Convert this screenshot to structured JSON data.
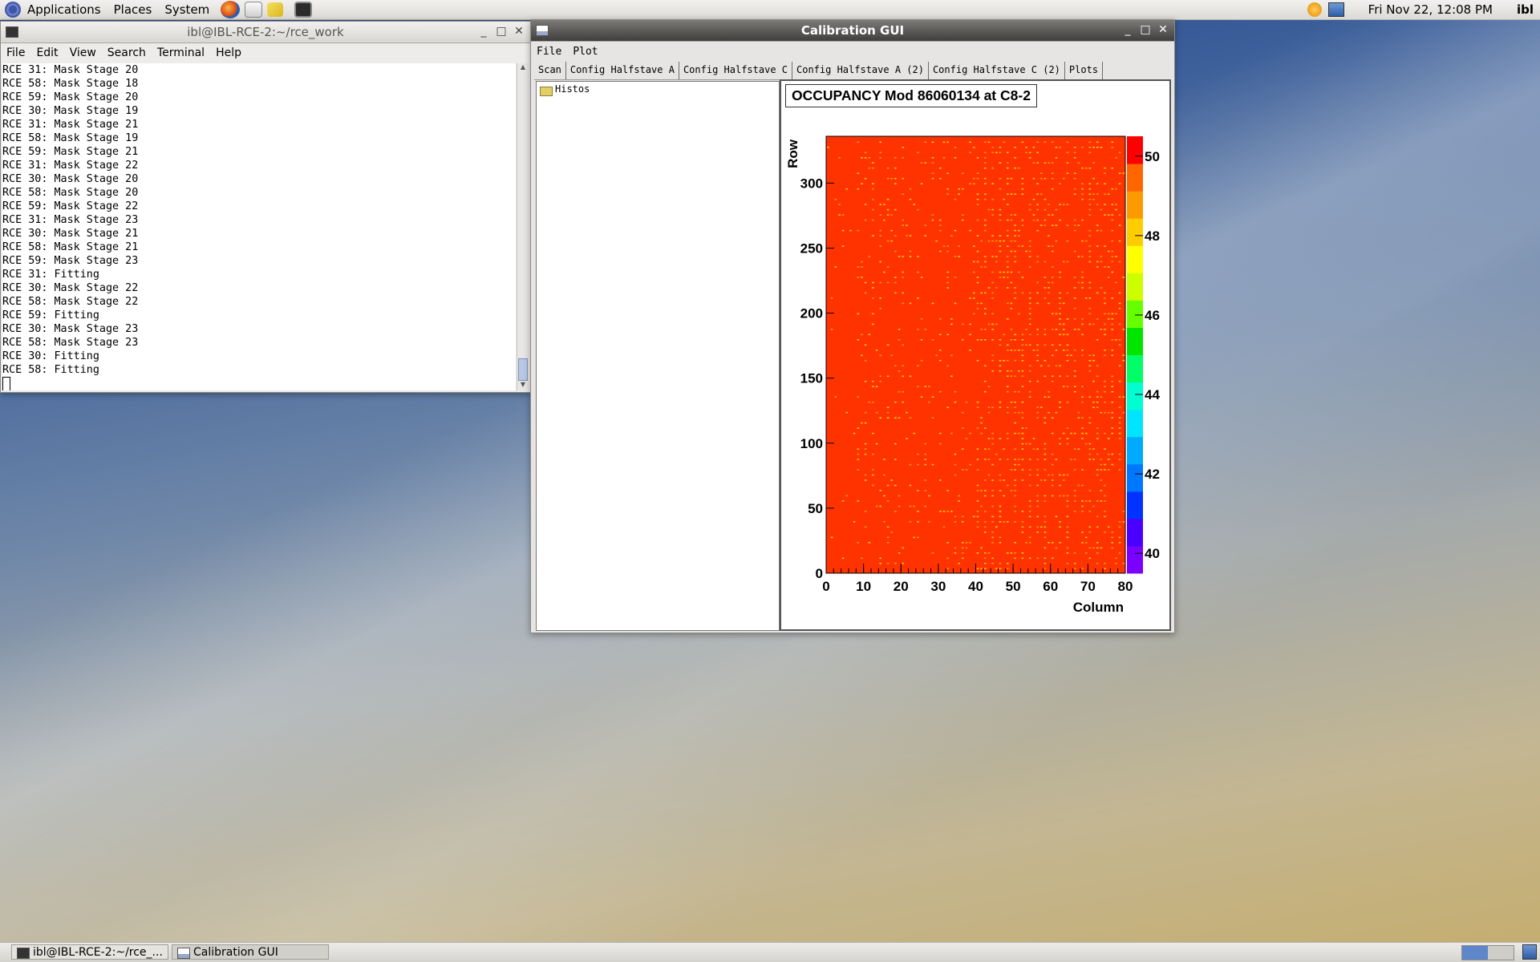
{
  "top_panel": {
    "menus": [
      "Applications",
      "Places",
      "System"
    ],
    "clock": "Fri Nov 22, 12:08 PM",
    "user": "ibl"
  },
  "terminal": {
    "title": "ibl@IBL-RCE-2:~/rce_work",
    "menus": [
      "File",
      "Edit",
      "View",
      "Search",
      "Terminal",
      "Help"
    ],
    "lines": [
      "RCE 31: Mask Stage 20",
      "RCE 58: Mask Stage 18",
      "RCE 59: Mask Stage 20",
      "RCE 30: Mask Stage 19",
      "RCE 31: Mask Stage 21",
      "RCE 58: Mask Stage 19",
      "RCE 59: Mask Stage 21",
      "RCE 31: Mask Stage 22",
      "RCE 30: Mask Stage 20",
      "RCE 58: Mask Stage 20",
      "RCE 59: Mask Stage 22",
      "RCE 31: Mask Stage 23",
      "RCE 30: Mask Stage 21",
      "RCE 58: Mask Stage 21",
      "RCE 59: Mask Stage 23",
      "RCE 31: Fitting",
      "RCE 30: Mask Stage 22",
      "RCE 58: Mask Stage 22",
      "RCE 59: Fitting",
      "RCE 30: Mask Stage 23",
      "RCE 58: Mask Stage 23",
      "RCE 30: Fitting",
      "RCE 58: Fitting"
    ]
  },
  "calib": {
    "title": "Calibration GUI",
    "menus": [
      "File",
      "Plot"
    ],
    "tabs": [
      "Scan",
      "Config Halfstave A",
      "Config Halfstave C",
      "Config Halfstave A (2)",
      "Config Halfstave C (2)",
      "Plots"
    ],
    "selected_tab": "Plots",
    "tree_item": "Histos"
  },
  "chart_data": {
    "type": "heatmap",
    "title": "OCCUPANCY Mod 86060134 at C8-2",
    "xlabel": "Column",
    "ylabel": "Row",
    "xlim": [
      0,
      80
    ],
    "ylim": [
      0,
      336
    ],
    "xticks": [
      0,
      10,
      20,
      30,
      40,
      50,
      60,
      70,
      80
    ],
    "yticks": [
      0,
      50,
      100,
      150,
      200,
      250,
      300
    ],
    "zlim": [
      39.5,
      50.5
    ],
    "zticks": [
      40,
      42,
      44,
      46,
      48,
      50
    ],
    "dominant_value": 50,
    "colors": {
      "high": "#ff3300",
      "mid": "#ffcc00",
      "palette": [
        "#7a00ff",
        "#4a00ff",
        "#0033ff",
        "#0077ff",
        "#00aaff",
        "#00e5ff",
        "#00ffd0",
        "#00ff66",
        "#00e600",
        "#66ff00",
        "#ccff00",
        "#ffff00",
        "#ffcc00",
        "#ff9900",
        "#ff6600",
        "#ff0000"
      ]
    }
  },
  "taskbar": {
    "items": [
      "ibl@IBL-RCE-2:~/rce_...",
      "Calibration GUI"
    ]
  }
}
